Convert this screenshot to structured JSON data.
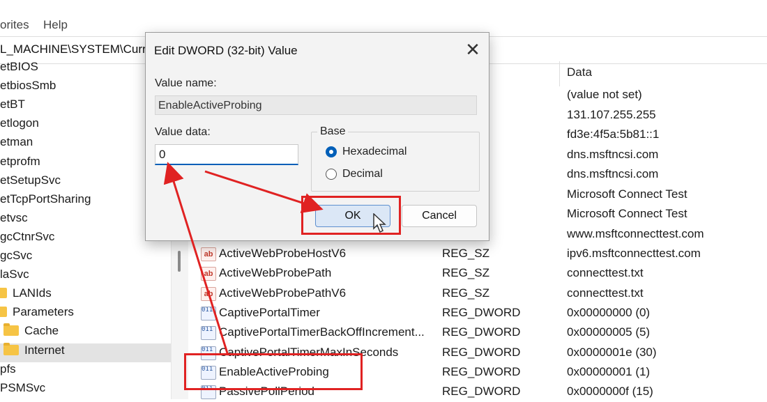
{
  "menubar": {
    "favorites": "orites",
    "help": "Help"
  },
  "address": "L_MACHINE\\SYSTEM\\Curr",
  "tree": [
    {
      "label": "etBIOS",
      "folder": false
    },
    {
      "label": "etbiosSmb",
      "folder": false
    },
    {
      "label": "etBT",
      "folder": false
    },
    {
      "label": "etlogon",
      "folder": false
    },
    {
      "label": "etman",
      "folder": false
    },
    {
      "label": "etprofm",
      "folder": false
    },
    {
      "label": "etSetupSvc",
      "folder": false
    },
    {
      "label": "etTcpPortSharing",
      "folder": false
    },
    {
      "label": "etvsc",
      "folder": false
    },
    {
      "label": "gcCtnrSvc",
      "folder": false
    },
    {
      "label": "gcSvc",
      "folder": false
    },
    {
      "label": "laSvc",
      "folder": false
    },
    {
      "label": "LANIds",
      "folder": true
    },
    {
      "label": "Parameters",
      "folder": true
    },
    {
      "label": "Cache",
      "folder": true
    },
    {
      "label": "Internet",
      "folder": true,
      "selected": true
    },
    {
      "label": "pfs",
      "folder": false
    },
    {
      "label": "PSMSvc",
      "folder": false
    }
  ],
  "columns": {
    "data": "Data"
  },
  "data_column_top": [
    "(value not set)",
    "131.107.255.255",
    "fd3e:4f5a:5b81::1",
    "dns.msftncsi.com",
    "dns.msftncsi.com",
    "Microsoft Connect Test",
    "Microsoft Connect Test",
    "www.msftconnecttest.com"
  ],
  "values": [
    {
      "name": "ActiveWebProbeHostV6",
      "type": "REG_SZ",
      "data": "ipv6.msftconnecttest.com",
      "kind": "sz"
    },
    {
      "name": "ActiveWebProbePath",
      "type": "REG_SZ",
      "data": "connecttest.txt",
      "kind": "sz"
    },
    {
      "name": "ActiveWebProbePathV6",
      "type": "REG_SZ",
      "data": "connecttest.txt",
      "kind": "sz"
    },
    {
      "name": "CaptivePortalTimer",
      "type": "REG_DWORD",
      "data": "0x00000000 (0)",
      "kind": "dword"
    },
    {
      "name": "CaptivePortalTimerBackOffIncrement...",
      "type": "REG_DWORD",
      "data": "0x00000005 (5)",
      "kind": "dword"
    },
    {
      "name": "CaptivePortalTimerMaxInSeconds",
      "type": "REG_DWORD",
      "data": "0x0000001e (30)",
      "kind": "dword"
    },
    {
      "name": "EnableActiveProbing",
      "type": "REG_DWORD",
      "data": "0x00000001 (1)",
      "kind": "dword"
    },
    {
      "name": "PassivePollPeriod",
      "type": "REG_DWORD",
      "data": "0x0000000f (15)",
      "kind": "dword"
    }
  ],
  "dialog": {
    "title": "Edit DWORD (32-bit) Value",
    "close_glyph": "✕",
    "value_name_label": "Value name:",
    "value_name": "EnableActiveProbing",
    "value_data_label": "Value data:",
    "value_data": "0",
    "base_label": "Base",
    "hex_label": "Hexadecimal",
    "dec_label": "Decimal",
    "base_selected": "Hexadecimal",
    "ok_label": "OK",
    "cancel_label": "Cancel"
  },
  "annotation_color": "#e02222"
}
